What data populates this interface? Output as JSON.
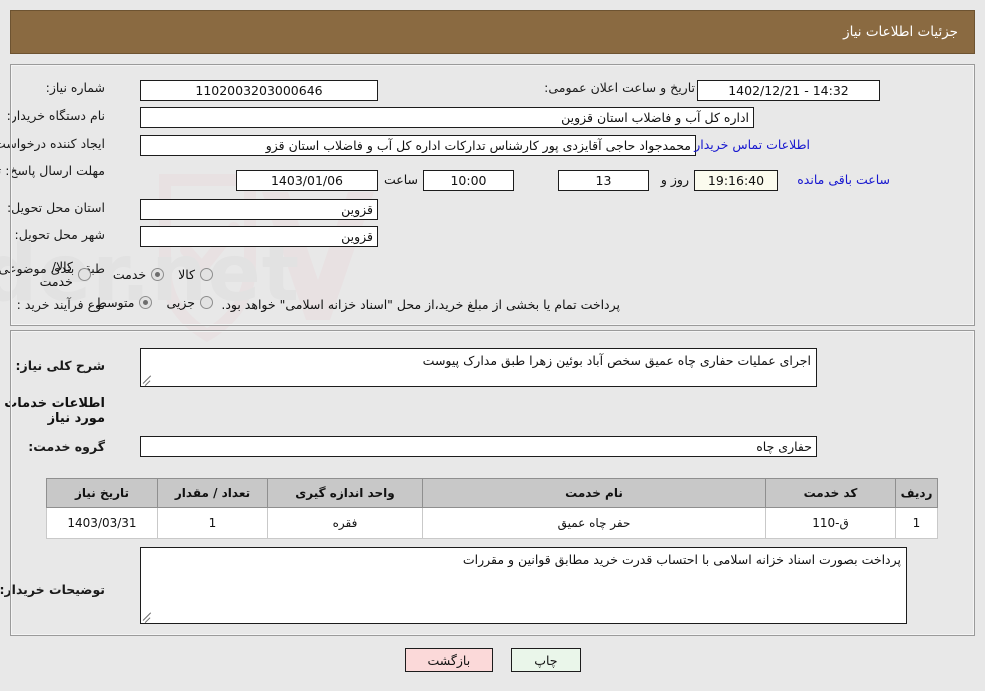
{
  "header": {
    "title": "جزئیات اطلاعات نیاز"
  },
  "form": {
    "need_number_label": "شماره نیاز:",
    "need_number_value": "1102003203000646",
    "announce_datetime_label": "تاریخ و ساعت اعلان عمومی:",
    "announce_datetime_value": "14:32 - 1402/12/21",
    "buyer_org_label": "نام دستگاه خریدار:",
    "buyer_org_value": "اداره کل آب و فاضلاب استان قزوین",
    "requester_label": "ایجاد کننده درخواست:",
    "requester_value": "محمدجواد حاجی آقایزدی پور کارشناس تدارکات اداره کل آب و فاضلاب استان قزو",
    "buyer_contact_link": "اطلاعات تماس خریدار",
    "deadline_label": "مهلت ارسال پاسخ: تا تاریخ:",
    "deadline_date": "1403/01/06",
    "deadline_hour_label": "ساعت",
    "deadline_hour_value": "10:00",
    "days_value": "13",
    "days_label": "روز و",
    "countdown_value": "19:16:40",
    "countdown_label": "ساعت باقی مانده",
    "delivery_province_label": "استان محل تحویل:",
    "delivery_province_value": "قزوین",
    "delivery_city_label": "شهر محل تحویل:",
    "delivery_city_value": "قزوین",
    "category_label": "طبقه بندی موضوعی:",
    "category_options": [
      {
        "label": "کالا",
        "selected": false
      },
      {
        "label": "خدمت",
        "selected": true
      },
      {
        "label": "کالا/خدمت",
        "selected": false
      }
    ],
    "process_label": "نوع فرآیند خرید :",
    "process_options": [
      {
        "label": "جزیی",
        "selected": false
      },
      {
        "label": "متوسط",
        "selected": true
      }
    ],
    "payment_note": "پرداخت تمام یا بخشی از مبلغ خرید،از محل \"اسناد خزانه اسلامی\" خواهد بود."
  },
  "description": {
    "label": "شرح کلی نیاز:",
    "value": "اجرای عملیات حفاری چاه عمیق سخص آباد  بوئین زهرا طبق مدارک پیوست"
  },
  "services": {
    "heading": "اطلاعات خدمات مورد نیاز",
    "group_label": "گروه خدمت:",
    "group_value": "حفاری چاه",
    "table": {
      "columns": [
        "ردیف",
        "کد خدمت",
        "نام خدمت",
        "واحد اندازه گیری",
        "تعداد / مقدار",
        "تاریخ نیاز"
      ],
      "rows": [
        [
          "1",
          "ق-110",
          "حفر چاه عمیق",
          "فقره",
          "1",
          "1403/03/31"
        ]
      ]
    }
  },
  "buyer_notes": {
    "label": "توضیحات خریدار:",
    "value": "پرداخت بصورت اسناد خزانه اسلامی با احتساب قدرت خرید مطابق قوانین و مقررات"
  },
  "buttons": {
    "print": "چاپ",
    "back": "بازگشت"
  },
  "watermark": {
    "text": "AriaTender.net"
  }
}
